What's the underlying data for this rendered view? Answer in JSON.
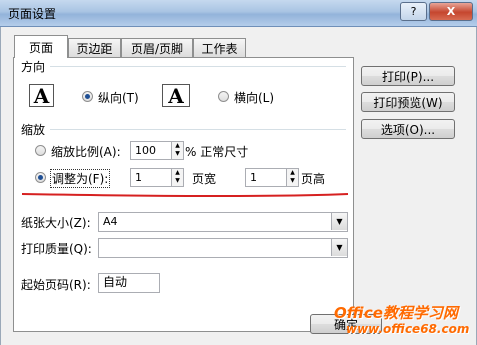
{
  "window": {
    "title": "页面设置",
    "help_label": "?",
    "close_label": "X"
  },
  "tabs": [
    {
      "label": "页面",
      "active": true
    },
    {
      "label": "页边距",
      "active": false
    },
    {
      "label": "页眉/页脚",
      "active": false
    },
    {
      "label": "工作表",
      "active": false
    }
  ],
  "orientation": {
    "title": "方向",
    "icon_glyph": "A",
    "portrait_label": "纵向(T)",
    "landscape_label": "横向(L)",
    "selected": "portrait"
  },
  "scaling": {
    "title": "缩放",
    "adjust_label": "缩放比例(A):",
    "adjust_value": "100",
    "adjust_suffix": "% 正常尺寸",
    "fit_label": "调整为(F):",
    "pages_wide_value": "1",
    "pages_wide_suffix": "页宽",
    "pages_tall_value": "1",
    "pages_tall_suffix": "页高",
    "selected": "fit"
  },
  "paper_size": {
    "label": "纸张大小(Z):",
    "value": "A4"
  },
  "print_quality": {
    "label": "打印质量(Q):",
    "value": ""
  },
  "first_page": {
    "label": "起始页码(R):",
    "value": "自动"
  },
  "side_buttons": {
    "print": "打印(P)...",
    "preview": "打印预览(W)",
    "options": "选项(O)..."
  },
  "bottom_button": "确定",
  "watermark": {
    "brand": "Office教程学习网",
    "url": "www.office68.com"
  },
  "colors": {
    "annotation_red": "#d62020",
    "watermark_orange": "#ff6a00"
  }
}
